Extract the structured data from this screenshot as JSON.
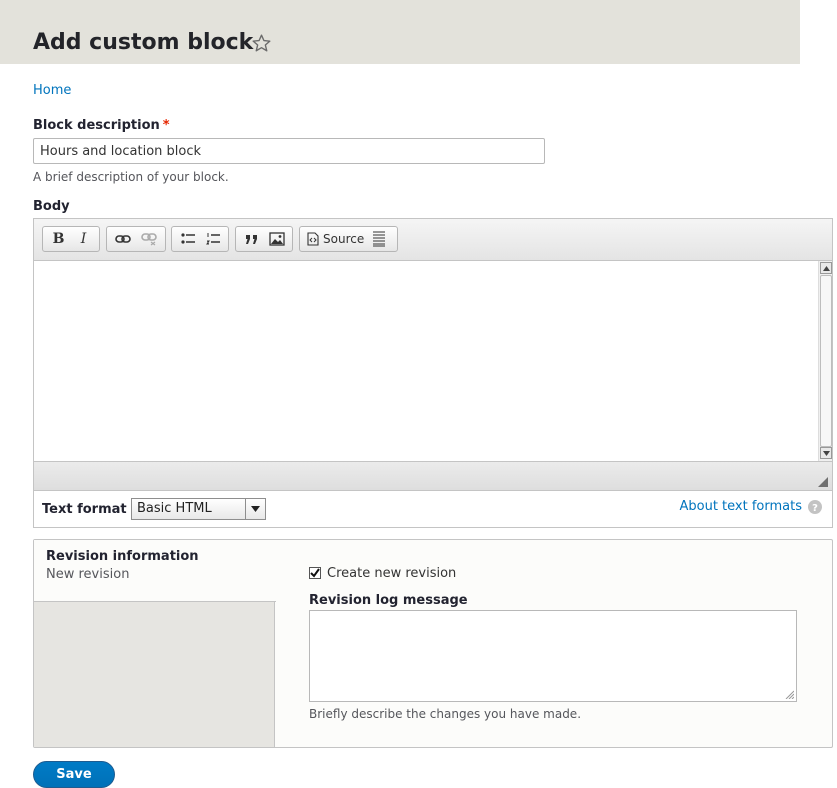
{
  "header": {
    "title": "Add custom block"
  },
  "breadcrumb": {
    "home": "Home"
  },
  "block_description": {
    "label": "Block description",
    "required_mark": "*",
    "value": "Hours and location block",
    "help": "A brief description of your block."
  },
  "body": {
    "label": "Body",
    "toolbar": {
      "bold": "B",
      "italic": "I",
      "source_label": "Source"
    }
  },
  "text_format": {
    "label": "Text format",
    "selected": "Basic HTML",
    "about_link": "About text formats"
  },
  "revision": {
    "tab_title": "Revision information",
    "tab_summary": "New revision",
    "checkbox_label": "Create new revision",
    "checkbox_checked": true,
    "log_label": "Revision log message",
    "log_help": "Briefly describe the changes you have made."
  },
  "actions": {
    "save": "Save"
  },
  "colors": {
    "link": "#0074bd",
    "primary_button": "#0071b8",
    "header_bg": "#e3e2db",
    "required": "#e62600"
  }
}
